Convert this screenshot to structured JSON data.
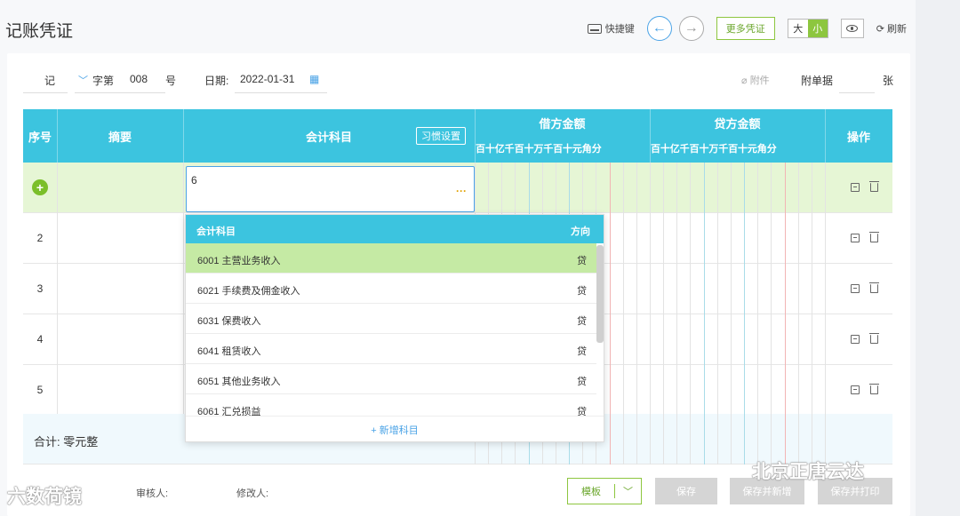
{
  "header": {
    "title": "记账凭证",
    "shortcut_label": "快捷键",
    "prev_icon": "arrow-left-icon",
    "next_icon": "arrow-right-icon",
    "more_label": "更多凭证",
    "size_big": "大",
    "size_small": "小",
    "refresh_label": "刷新",
    "accent_color": "#3cc4df",
    "green_color": "#8dc63f"
  },
  "meta": {
    "voucher_type": "记",
    "word_label": "字第",
    "number": "008",
    "number_unit": "号",
    "date_label": "日期:",
    "date_value": "2022-01-31",
    "attachment_label": "附件",
    "attach_docs_label": "附单据",
    "attach_count": "",
    "attach_unit": "张"
  },
  "table": {
    "col_seq": "序号",
    "col_summary": "摘要",
    "col_subject": "会计科目",
    "habit_button": "习惯设置",
    "col_debit": "借方金额",
    "col_credit": "贷方金额",
    "col_ops": "操作",
    "digit_units": [
      "百",
      "十",
      "亿",
      "千",
      "百",
      "十",
      "万",
      "千",
      "百",
      "十",
      "元",
      "角",
      "分"
    ],
    "rows": [
      {
        "seq": "",
        "summary": "",
        "subject": "6"
      },
      {
        "seq": "2",
        "summary": "",
        "subject": ""
      },
      {
        "seq": "3",
        "summary": "",
        "subject": ""
      },
      {
        "seq": "4",
        "summary": "",
        "subject": ""
      },
      {
        "seq": "5",
        "summary": "",
        "subject": ""
      }
    ],
    "total_label": "合计: 零元整"
  },
  "dropdown": {
    "col_subject": "会计科目",
    "col_direction": "方向",
    "items": [
      {
        "label": "6001 主营业务收入",
        "direction": "贷"
      },
      {
        "label": "6021 手续费及佣金收入",
        "direction": "贷"
      },
      {
        "label": "6031 保费收入",
        "direction": "贷"
      },
      {
        "label": "6041 租赁收入",
        "direction": "贷"
      },
      {
        "label": "6051 其他业务收入",
        "direction": "贷"
      },
      {
        "label": "6061 汇兑损益",
        "direction": "贷"
      }
    ],
    "add_label": "+ 新增科目"
  },
  "footer": {
    "reviewer_label": "审核人:",
    "modifier_label": "修改人:",
    "template_label": "模板",
    "save_label": "保存",
    "save_new_label": "保存并新增",
    "save_print_label": "保存并打印"
  },
  "watermarks": {
    "left": "六数荷镜",
    "right": "北京正唐云达"
  }
}
